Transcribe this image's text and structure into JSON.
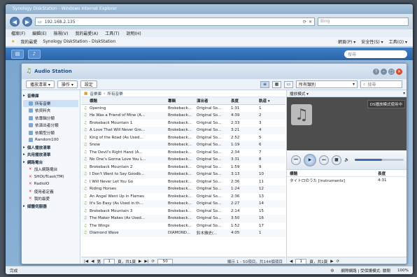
{
  "browser": {
    "title": "Synology DiskStation - Windows Internet Explorer",
    "url": "192.168.2.135",
    "bing_placeholder": "Bing",
    "menu": [
      "檔案(F)",
      "編輯(E)",
      "檢視(V)",
      "我的最愛(A)",
      "工具(T)",
      "說明(H)"
    ],
    "fav_label": "我的最愛",
    "tab_label": "Synology DiskStation - DiskStation",
    "fav_tools": [
      "網頁(P) ▾",
      "安全性(S) ▾",
      "工具(O) ▾"
    ],
    "status_left": "完成",
    "status_mid": "網際網路 | 受保護模式: 關閉",
    "zoom": "100%"
  },
  "dsm": {
    "search_placeholder": "搜尋"
  },
  "app": {
    "title": "Audio Station",
    "toolbar": {
      "add": "播放清單 ▾",
      "edit": "操作 ▾",
      "settings": "設定"
    },
    "category_select": "所有類別",
    "search_placeholder": "搜尋"
  },
  "sidebar": [
    {
      "type": "grp",
      "label": "音樂庫"
    },
    {
      "type": "it",
      "label": "所有音樂",
      "sel": true
    },
    {
      "type": "it",
      "label": "依資料夾"
    },
    {
      "type": "it",
      "label": "依專輯分類"
    },
    {
      "type": "it",
      "label": "依演出者分類"
    },
    {
      "type": "it",
      "label": "依類型分類"
    },
    {
      "type": "it",
      "label": "Random100"
    },
    {
      "type": "grp",
      "label": "個人播放清單"
    },
    {
      "type": "grp",
      "label": "共用播放清單"
    },
    {
      "type": "grp",
      "label": "網路電台"
    },
    {
      "type": "it",
      "label": "加入網路電台",
      "x": true
    },
    {
      "type": "it",
      "label": "SHOUTcast(TM)",
      "x": true
    },
    {
      "type": "it",
      "label": "RadioIO",
      "x": true
    },
    {
      "type": "it",
      "label": "使用者定義",
      "x": true
    },
    {
      "type": "it",
      "label": "我的最愛",
      "x": true
    },
    {
      "type": "grp",
      "label": "媒體伺服器"
    }
  ],
  "breadcrumb": [
    "音樂庫",
    "所有音樂"
  ],
  "columns": [
    "標題",
    "專輯",
    "演出者",
    "長度",
    "軌道 ▾"
  ],
  "tracks": [
    [
      "Opening",
      "Brokeback...",
      "Original So...",
      "1:31",
      "1"
    ],
    [
      "He Was a Friend of Mine (A...",
      "Brokeback...",
      "Original So...",
      "4:39",
      "2"
    ],
    [
      "Brokeback Mountain 1",
      "Brokeback...",
      "Original So...",
      "2:33",
      "3"
    ],
    [
      "A Love That Will Never Gro...",
      "Brokeback...",
      "Original So...",
      "3:21",
      "4"
    ],
    [
      "King of the Road (As Used...",
      "Brokeback...",
      "Original So...",
      "2:52",
      "5"
    ],
    [
      "Snow",
      "Brokeback...",
      "Original So...",
      "1:19",
      "6"
    ],
    [
      "The Devil's Right Hand (A...",
      "Brokeback...",
      "Original So...",
      "2:34",
      "7"
    ],
    [
      "No One's Gonna Love You L...",
      "Brokeback...",
      "Original So...",
      "3:31",
      "8"
    ],
    [
      "Brokeback Mountain 2",
      "Brokeback...",
      "Original So...",
      "1:59",
      "9"
    ],
    [
      "I Don't Want to Say Goodb...",
      "Brokeback...",
      "Original So...",
      "3:13",
      "10"
    ],
    [
      "I Will Never Let You Go",
      "Brokeback...",
      "Original So...",
      "2:36",
      "11"
    ],
    [
      "Riding Horses",
      "Brokeback...",
      "Original So...",
      "1:24",
      "12"
    ],
    [
      "An Angel Went Up in Flames",
      "Brokeback...",
      "Original So...",
      "2:36",
      "13"
    ],
    [
      "It's So Easy (As Used in th...",
      "Brokeback...",
      "Original So...",
      "2:27",
      "14"
    ],
    [
      "Brokeback Mountain 3",
      "Brokeback...",
      "Original So...",
      "2:14",
      "15"
    ],
    [
      "The Maker Makes (As Used...",
      "Brokeback...",
      "Original So...",
      "3:50",
      "16"
    ],
    [
      "The Wings",
      "Brokeback...",
      "Original So...",
      "1:52",
      "17"
    ],
    [
      "Diamond Wave",
      "DIAMOND...",
      "鈴木雅史(...",
      "4:05",
      "1"
    ]
  ],
  "pager": {
    "page_label": "第",
    "page": "1",
    "of": "頁，共1頁",
    "per_page": "50",
    "summary": "顯示 1 - 50項目，共144個項目"
  },
  "player": {
    "mode": "播放模式 ▾",
    "badge": "DS播放模式使用中",
    "volume_pct": 55,
    "queue_cols": [
      "標題",
      "長度"
    ],
    "queue": [
      [
        "タイトロのうた [instruments]",
        "4:31"
      ]
    ],
    "pager_page": "1",
    "pager_of": "頁，共1頁"
  }
}
